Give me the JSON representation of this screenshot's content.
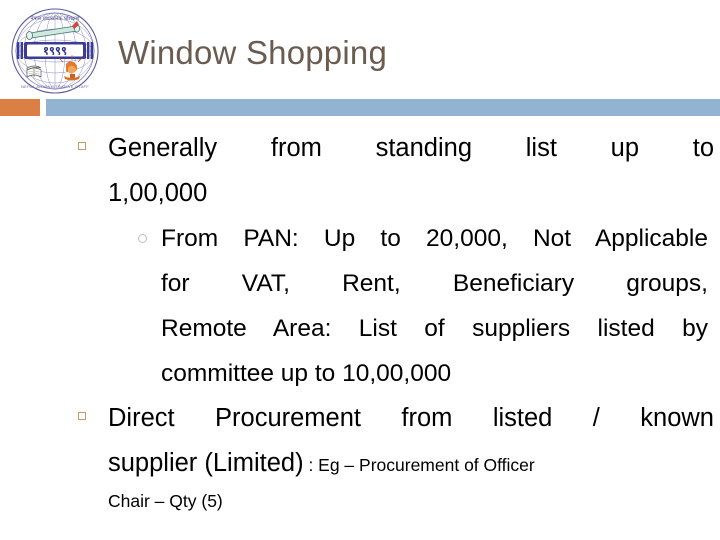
{
  "slide": {
    "title": "Window Shopping",
    "title_color": "#6b5c52",
    "accent_orange": "#db7f44",
    "accent_blue": "#93b3d2",
    "bullet_square_color": "#c49a6c",
    "bullet_circle_color": "#bdbdbd"
  },
  "logo": {
    "name": "nepal-administrative-staff-college-emblem",
    "year": "1999",
    "top_text": "नेपाल प्रशासनिक प्रशिक्षण प्रतिष्ठान",
    "bottom_text": "NEPAL ADMINISTRATIVE STAFF COLLEGE, 1982"
  },
  "content": {
    "bullets": [
      {
        "level": 1,
        "id": "generally-from-standing-list",
        "line1": "Generally from standing list up to",
        "line2": "1,00,000",
        "children": [
          {
            "level": 2,
            "id": "from-pan-limits",
            "line1": "From PAN: Up to 20,000, Not Applicable",
            "line2": "for VAT, Rent, Beneficiary groups,",
            "line3": "Remote Area: List of suppliers listed by",
            "line4": "committee  up to 10,00,000"
          }
        ]
      },
      {
        "level": 1,
        "id": "direct-procurement",
        "line1": "Direct Procurement from listed / known",
        "line2_main": "supplier (Limited)",
        "line2_note": " : Eg – Procurement of Officer",
        "line3_note": "Chair – Qty (5)"
      }
    ]
  }
}
